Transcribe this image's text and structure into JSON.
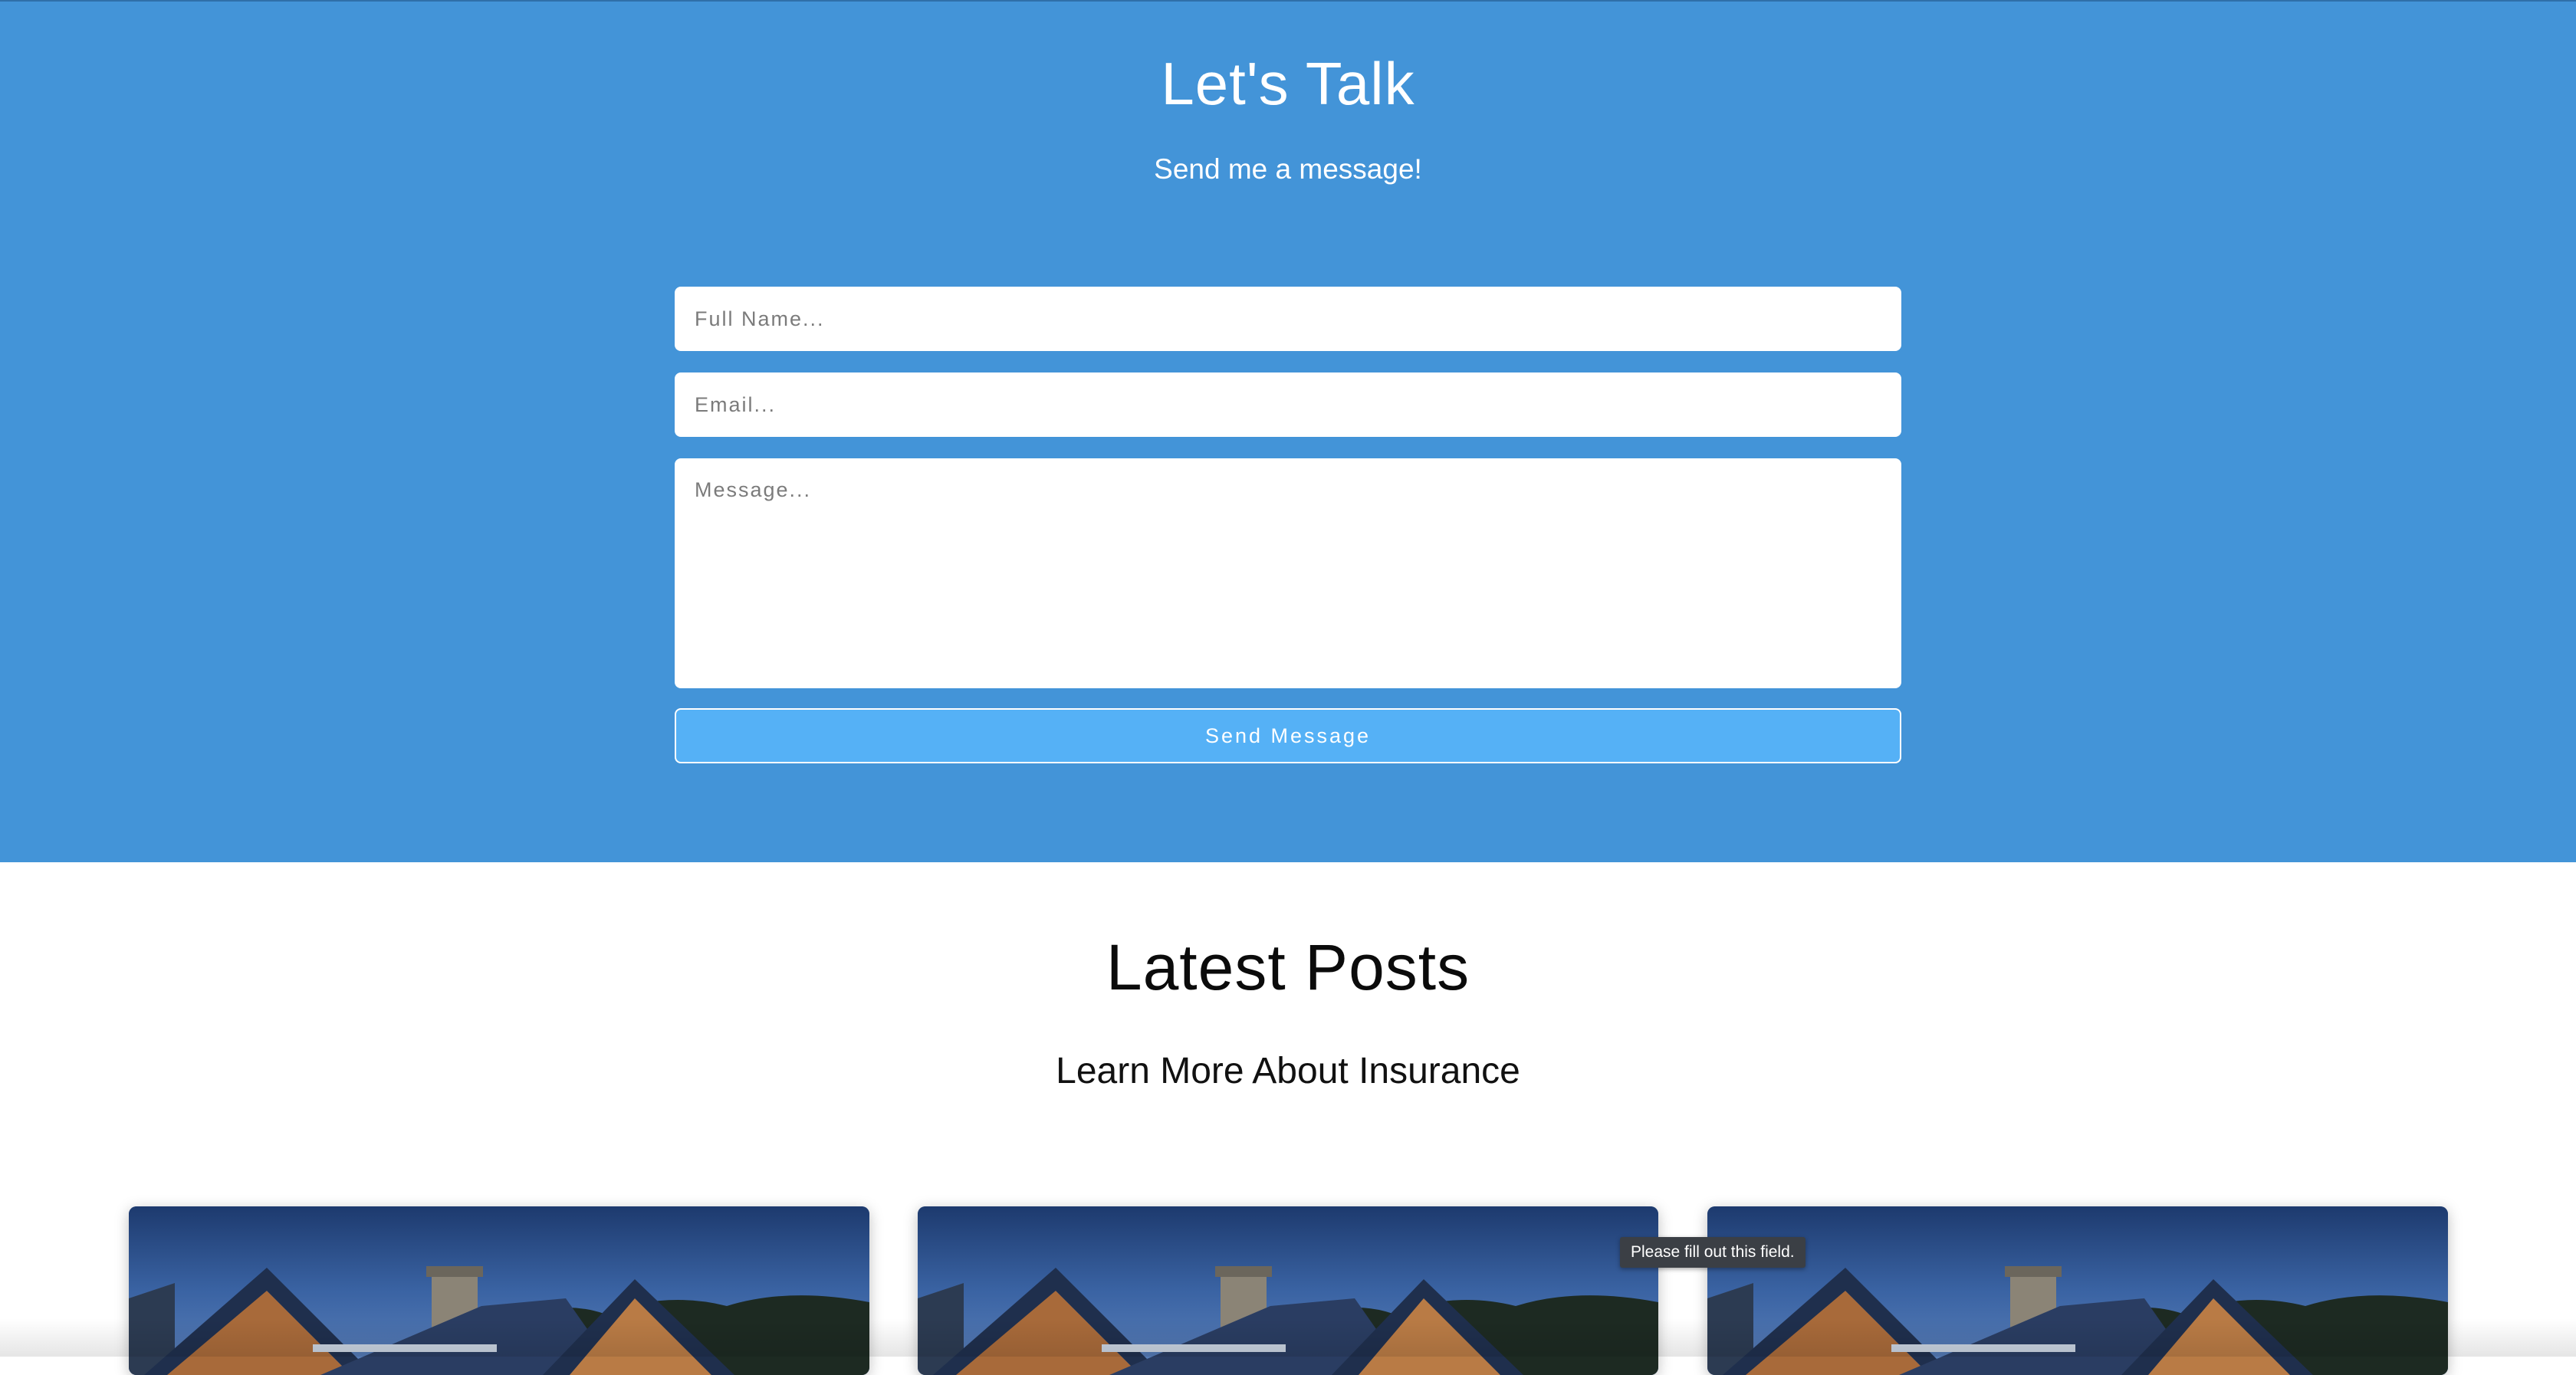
{
  "contact": {
    "title": "Let's Talk",
    "subtitle": "Send me a message!",
    "name_placeholder": "Full Name...",
    "email_placeholder": "Email...",
    "message_placeholder": "Message...",
    "send_label": "Send Message",
    "background_color": "#4394d8",
    "button_color": "#55b1f6"
  },
  "posts": {
    "title": "Latest Posts",
    "subtitle": "Learn More About Insurance",
    "cards": [
      {
        "image": "house-roof-night-photo"
      },
      {
        "image": "house-roof-night-photo"
      },
      {
        "image": "house-roof-night-photo"
      }
    ]
  },
  "tooltip": {
    "text": "Please fill out this field."
  }
}
